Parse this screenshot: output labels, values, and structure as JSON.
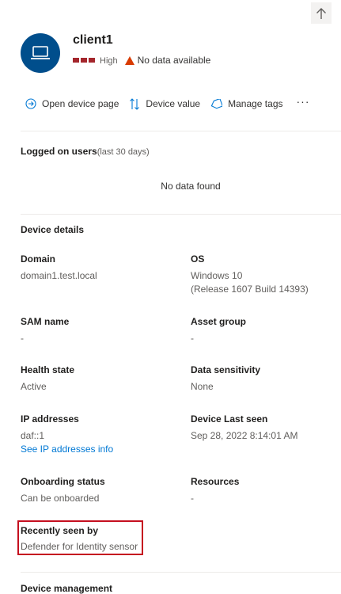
{
  "device": {
    "name": "client1",
    "risk_level": "High",
    "alert_status": "No data available"
  },
  "toolbar": {
    "open_device_page": "Open device page",
    "device_value": "Device value",
    "manage_tags": "Manage tags",
    "more": "···"
  },
  "logged_on_users": {
    "title": "Logged on users",
    "subtitle": "(last 30 days)",
    "empty": "No data found"
  },
  "device_details": {
    "title": "Device details",
    "domain_label": "Domain",
    "domain_value": "domain1.test.local",
    "os_label": "OS",
    "os_line1": "Windows 10",
    "os_line2": "(Release 1607 Build 14393)",
    "sam_label": "SAM name",
    "sam_value": "-",
    "asset_label": "Asset group",
    "asset_value": "-",
    "health_label": "Health state",
    "health_value": "Active",
    "sensitivity_label": "Data sensitivity",
    "sensitivity_value": "None",
    "ip_label": "IP addresses",
    "ip_value": "daf::1",
    "ip_link": "See IP addresses info",
    "last_seen_label": "Device Last seen",
    "last_seen_value": "Sep 28, 2022 8:14:01 AM",
    "onboarding_label": "Onboarding status",
    "onboarding_value": "Can be onboarded",
    "resources_label": "Resources",
    "resources_value": "-",
    "recently_seen_label": "Recently seen by",
    "recently_seen_value": "Defender for Identity sensor"
  },
  "device_management": {
    "title": "Device management"
  },
  "colors": {
    "accent": "#0078d4",
    "avatar": "#004e8c",
    "risk_high": "#a4262c",
    "warning": "#d83b01",
    "highlight": "#c50f1f"
  }
}
